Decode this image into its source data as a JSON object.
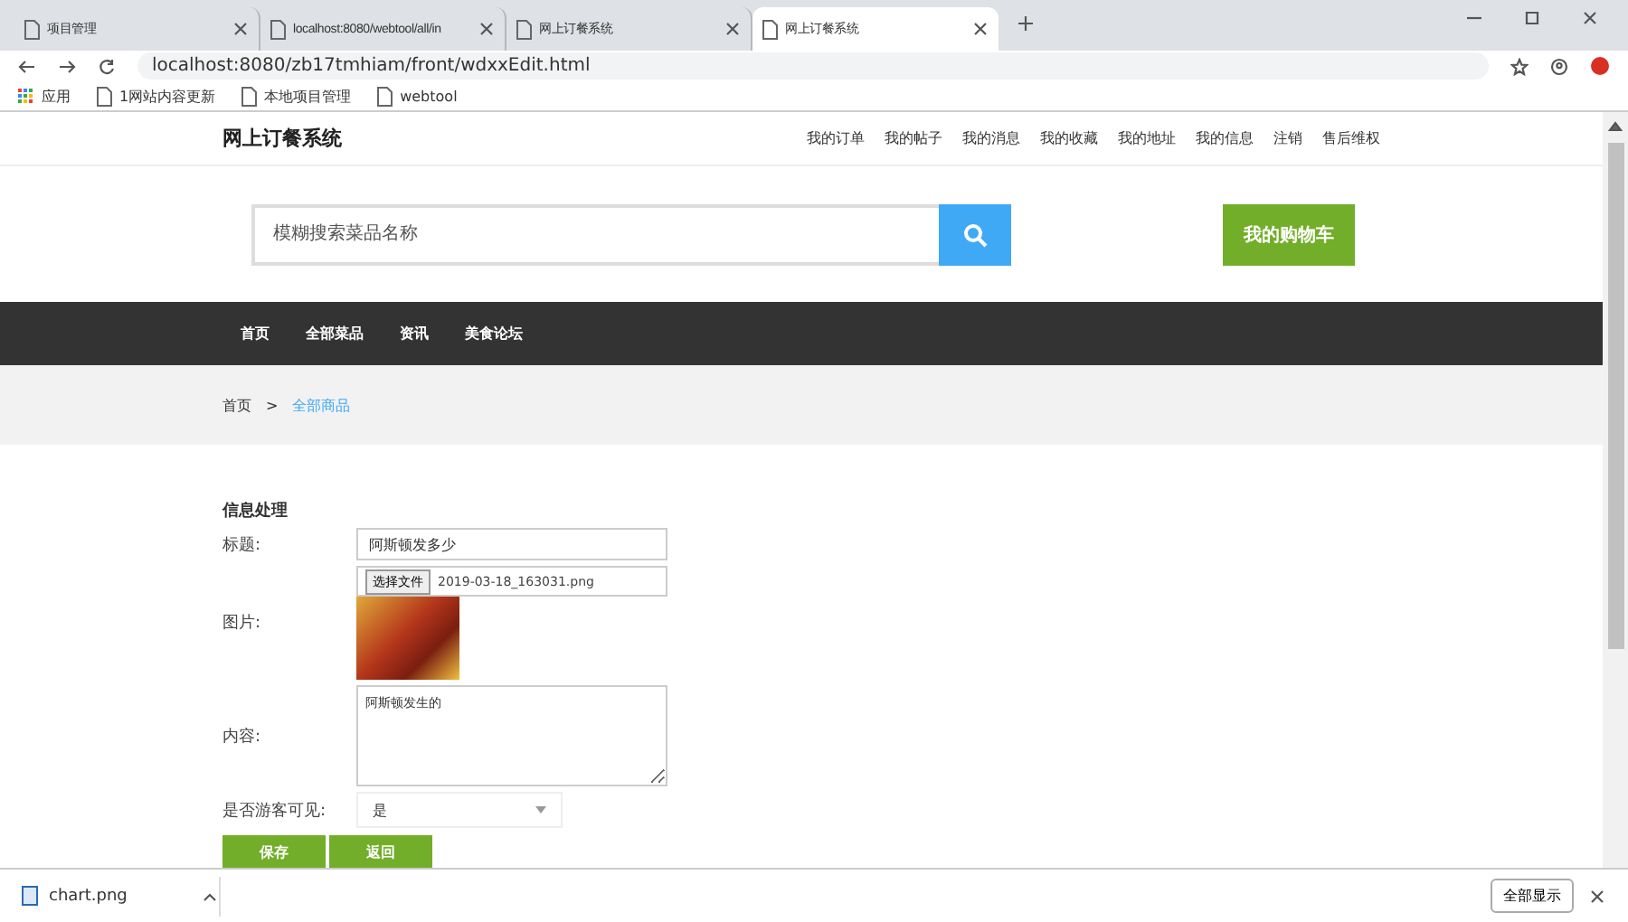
{
  "browser": {
    "tabs": [
      {
        "title": "项目管理",
        "selected": false
      },
      {
        "title": "localhost:8080/webtool/all/in",
        "selected": false
      },
      {
        "title": "网上订餐系统",
        "selected": false
      },
      {
        "title": "网上订餐系统",
        "selected": true
      }
    ],
    "url": "localhost:8080/zb17tmhiam/front/wdxxEdit.html",
    "bookmarks": [
      {
        "label": "应用"
      },
      {
        "label": "1网站内容更新"
      },
      {
        "label": "本地项目管理"
      },
      {
        "label": "webtool"
      }
    ]
  },
  "site": {
    "title": "网上订餐系统",
    "user_menu": [
      "我的订单",
      "我的帖子",
      "我的消息",
      "我的收藏",
      "我的地址",
      "我的信息",
      "注销",
      "售后维权"
    ],
    "search": {
      "placeholder": "模糊搜索菜品名称"
    },
    "cart_button": "我的购物车",
    "nav": [
      "首页",
      "全部菜品",
      "资讯",
      "美食论坛"
    ],
    "breadcrumb_separator": ">",
    "breadcrumb": [
      {
        "label": "首页",
        "current": false
      },
      {
        "label": "全部商品",
        "current": true
      }
    ],
    "form": {
      "heading": "信息处理",
      "fields": [
        {
          "kind": "text",
          "label": "标题:",
          "value": "阿斯顿发多少"
        },
        {
          "kind": "file",
          "label": "图片:",
          "button": "选择文件",
          "file_name": "2019-03-18_163031.png"
        },
        {
          "kind": "textarea",
          "label": "内容:",
          "value": "阿斯顿发生的"
        },
        {
          "kind": "select",
          "label": "是否游客可见:",
          "value": "是"
        }
      ],
      "buttons": [
        "保存",
        "返回"
      ]
    }
  },
  "downloads": {
    "file": "chart.png",
    "show_all": "全部显示"
  }
}
